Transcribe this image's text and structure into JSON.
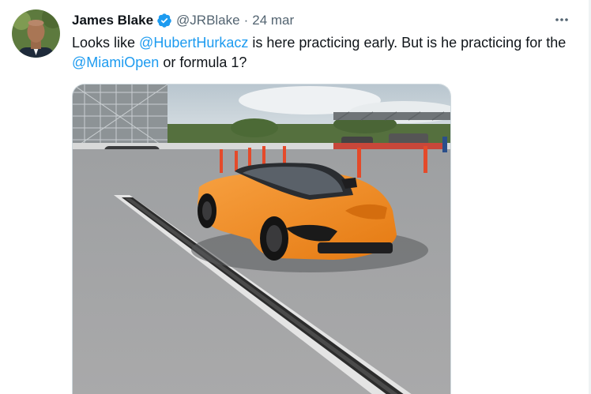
{
  "author": {
    "name": "James Blake",
    "handle": "@JRBlake",
    "separator": "·",
    "date": "24 mar"
  },
  "tweet": {
    "text_1": "Looks like ",
    "mention_1": "@HubertHurkacz",
    "text_2": " is here practicing early.  But is he practicing for the ",
    "mention_2": "@MiamiOpen",
    "text_3": " or formula 1?"
  },
  "icons": {
    "verified": "verified-badge-icon",
    "more": "more-horizontal-icon"
  },
  "colors": {
    "link": "#1d9bf0",
    "verified": "#1d9bf0",
    "secondary_text": "#536471",
    "car": "#f28a1f"
  }
}
